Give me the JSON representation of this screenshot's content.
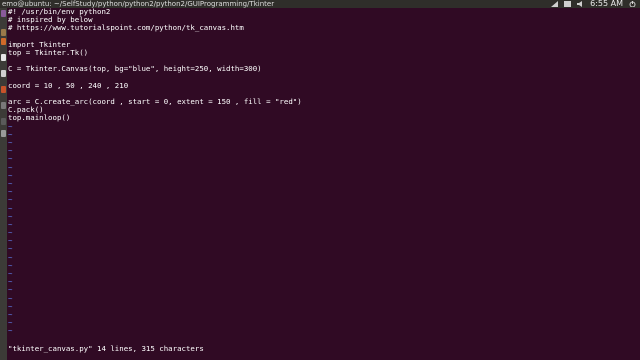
{
  "window": {
    "title": "emo@ubuntu: ~/SelfStudy/python/python2/python2/GUIProgramming/Tkinter",
    "clock": "6:55 AM"
  },
  "editor": {
    "lines": [
      "#! /usr/bin/env python2",
      "# inspired by below",
      "# https://www.tutorialspoint.com/python/tk_canvas.htm",
      "",
      "import Tkinter",
      "top = Tkinter.Tk()",
      "",
      "C = Tkinter.Canvas(top, bg=\"blue\", height=250, width=300)",
      "",
      "coord = 10 , 50 , 240 , 210",
      "",
      "arc = C.create_arc(coord , start = 0, extent = 150 , fill = \"red\")",
      "C.pack()",
      "top.mainloop()"
    ],
    "empty_marker": "~",
    "status": "\"tkinter_canvas.py\" 14 lines, 315 characters"
  },
  "colors": {
    "background": "#300a24",
    "tilde": "#5f7de8",
    "text": "#ffffff"
  },
  "icons": [
    "dash-icon",
    "files-icon",
    "browser-icon",
    "office-icon",
    "software-center-icon",
    "settings-icon",
    "terminal-icon",
    "trash-icon"
  ]
}
